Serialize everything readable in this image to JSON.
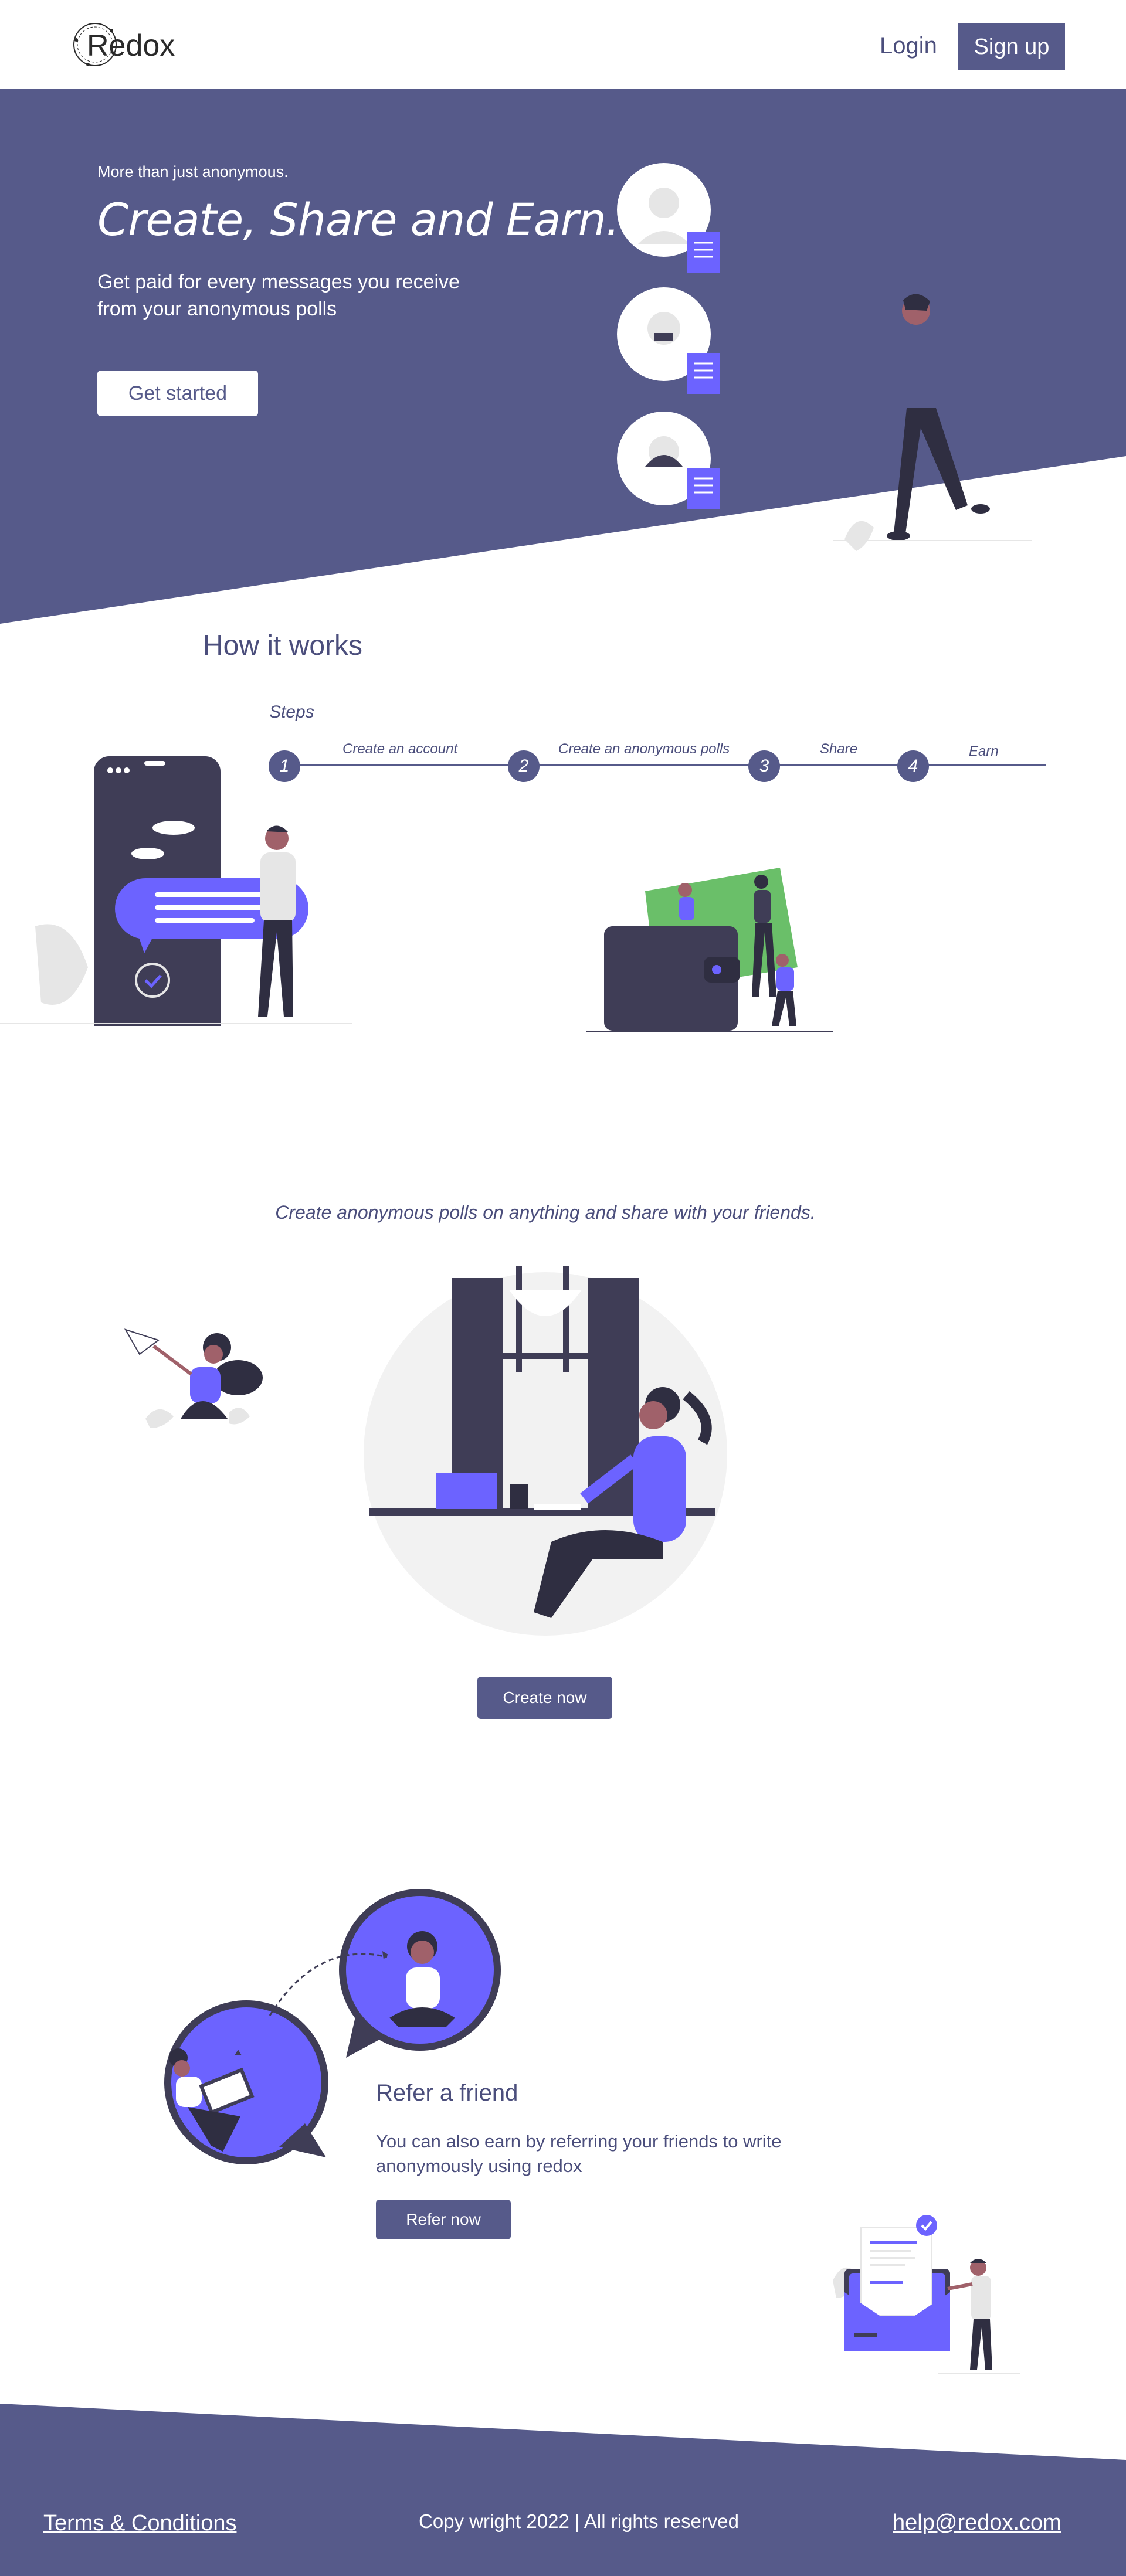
{
  "colors": {
    "brand": "#565a8a",
    "accent": "#6c63ff",
    "dark": "#3f3d56",
    "light": "#f2f2f2",
    "green": "#6abf69"
  },
  "header": {
    "logo_text": "Redox",
    "login_label": "Login",
    "signup_label": "Sign up"
  },
  "hero": {
    "eyebrow": "More than just anonymous.",
    "title": "Create, Share and Earn.",
    "subtitle": "Get paid for every messages you receive from your anonymous polls",
    "cta_label": "Get started"
  },
  "how": {
    "title": "How it works",
    "steps_label": "Steps",
    "steps": [
      {
        "number": "1",
        "label": "Create an account"
      },
      {
        "number": "2",
        "label": "Create an anonymous polls"
      },
      {
        "number": "3",
        "label": "Share"
      },
      {
        "number": "4",
        "label": "Earn"
      }
    ]
  },
  "polls": {
    "tagline": "Create anonymous polls on anything and share with your friends.",
    "cta_label": "Create now"
  },
  "refer": {
    "title": "Refer a friend",
    "text": "You can also earn by referring your friends to write anonymously using redox",
    "cta_label": "Refer now"
  },
  "footer": {
    "terms": "Terms & Conditions",
    "copyright": "Copy wright 2022 | All rights reserved",
    "email": "help@redox.com"
  },
  "icons": [
    "logo-mark-icon",
    "check-icon",
    "chat-bubble-icon",
    "document-icon",
    "paper-plane-icon",
    "laptop-icon",
    "mail-icon",
    "wallet-icon"
  ]
}
